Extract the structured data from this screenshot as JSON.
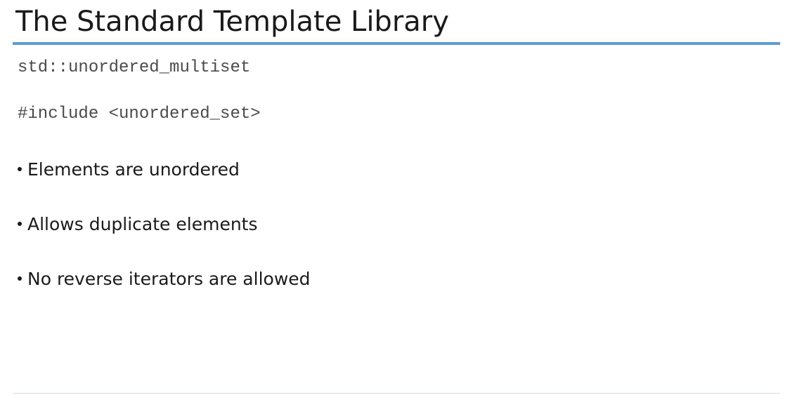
{
  "slide": {
    "title": "The Standard Template Library",
    "code_lines": [
      "std::unordered_multiset",
      "#include <unordered_set>"
    ],
    "bullets": [
      "Elements are unordered",
      "Allows duplicate elements",
      "No reverse iterators are allowed"
    ]
  },
  "colors": {
    "accent_rule": "#5b9bd5",
    "text": "#1a1a1a",
    "code_text": "#4a4a4a"
  }
}
